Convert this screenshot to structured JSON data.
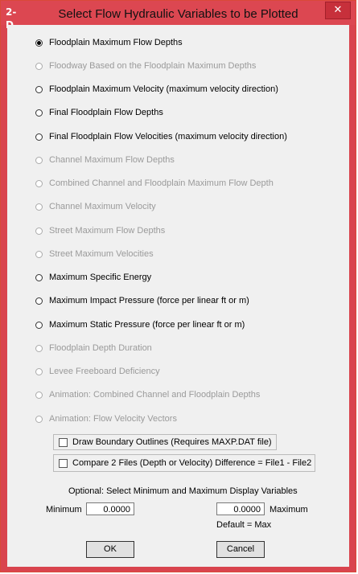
{
  "window": {
    "title": "Select Flow Hydraulic Variables to be Plotted",
    "app_icon": "2-D",
    "close_label": "✕"
  },
  "options": [
    {
      "label": "Floodplain Maximum Flow Depths",
      "checked": true,
      "enabled": true
    },
    {
      "label": "Floodway Based on the Floodplain Maximum Depths",
      "checked": false,
      "enabled": false
    },
    {
      "label": "Floodplain Maximum Velocity (maximum velocity direction)",
      "checked": false,
      "enabled": true
    },
    {
      "label": "Final Floodplain Flow Depths",
      "checked": false,
      "enabled": true
    },
    {
      "label": "Final Floodplain Flow Velocities (maximum velocity direction)",
      "checked": false,
      "enabled": true
    },
    {
      "label": "Channel Maximum Flow Depths",
      "checked": false,
      "enabled": false
    },
    {
      "label": "Combined Channel and Floodplain Maximum Flow Depth",
      "checked": false,
      "enabled": false
    },
    {
      "label": "Channel Maximum Velocity",
      "checked": false,
      "enabled": false
    },
    {
      "label": "Street Maximum Flow Depths",
      "checked": false,
      "enabled": false
    },
    {
      "label": "Street Maximum Velocities",
      "checked": false,
      "enabled": false
    },
    {
      "label": "Maximum Specific Energy",
      "checked": false,
      "enabled": true
    },
    {
      "label": "Maximum Impact Pressure  (force per linear ft or m)",
      "checked": false,
      "enabled": true
    },
    {
      "label": "Maximum Static Pressure (force per linear ft or m)",
      "checked": false,
      "enabled": true
    },
    {
      "label": "Floodplain Depth Duration",
      "checked": false,
      "enabled": false
    },
    {
      "label": "Levee Freeboard Deficiency",
      "checked": false,
      "enabled": false
    },
    {
      "label": "Animation:  Combined Channel and Floodplain Depths",
      "checked": false,
      "enabled": false
    },
    {
      "label": "Animation:  Flow Velocity Vectors",
      "checked": false,
      "enabled": false
    }
  ],
  "checkboxes": {
    "draw_boundary": "Draw Boundary Outlines (Requires MAXP.DAT file)",
    "compare_files": "Compare 2 Files (Depth or Velocity)   Difference = File1 - File2"
  },
  "range": {
    "caption": "Optional:  Select Minimum and Maximum Display Variables",
    "min_label": "Minimum",
    "min_value": "0.0000",
    "max_label": "Maximum",
    "max_value": "0.0000",
    "default_note": "Default = Max"
  },
  "buttons": {
    "ok": "OK",
    "cancel": "Cancel"
  }
}
